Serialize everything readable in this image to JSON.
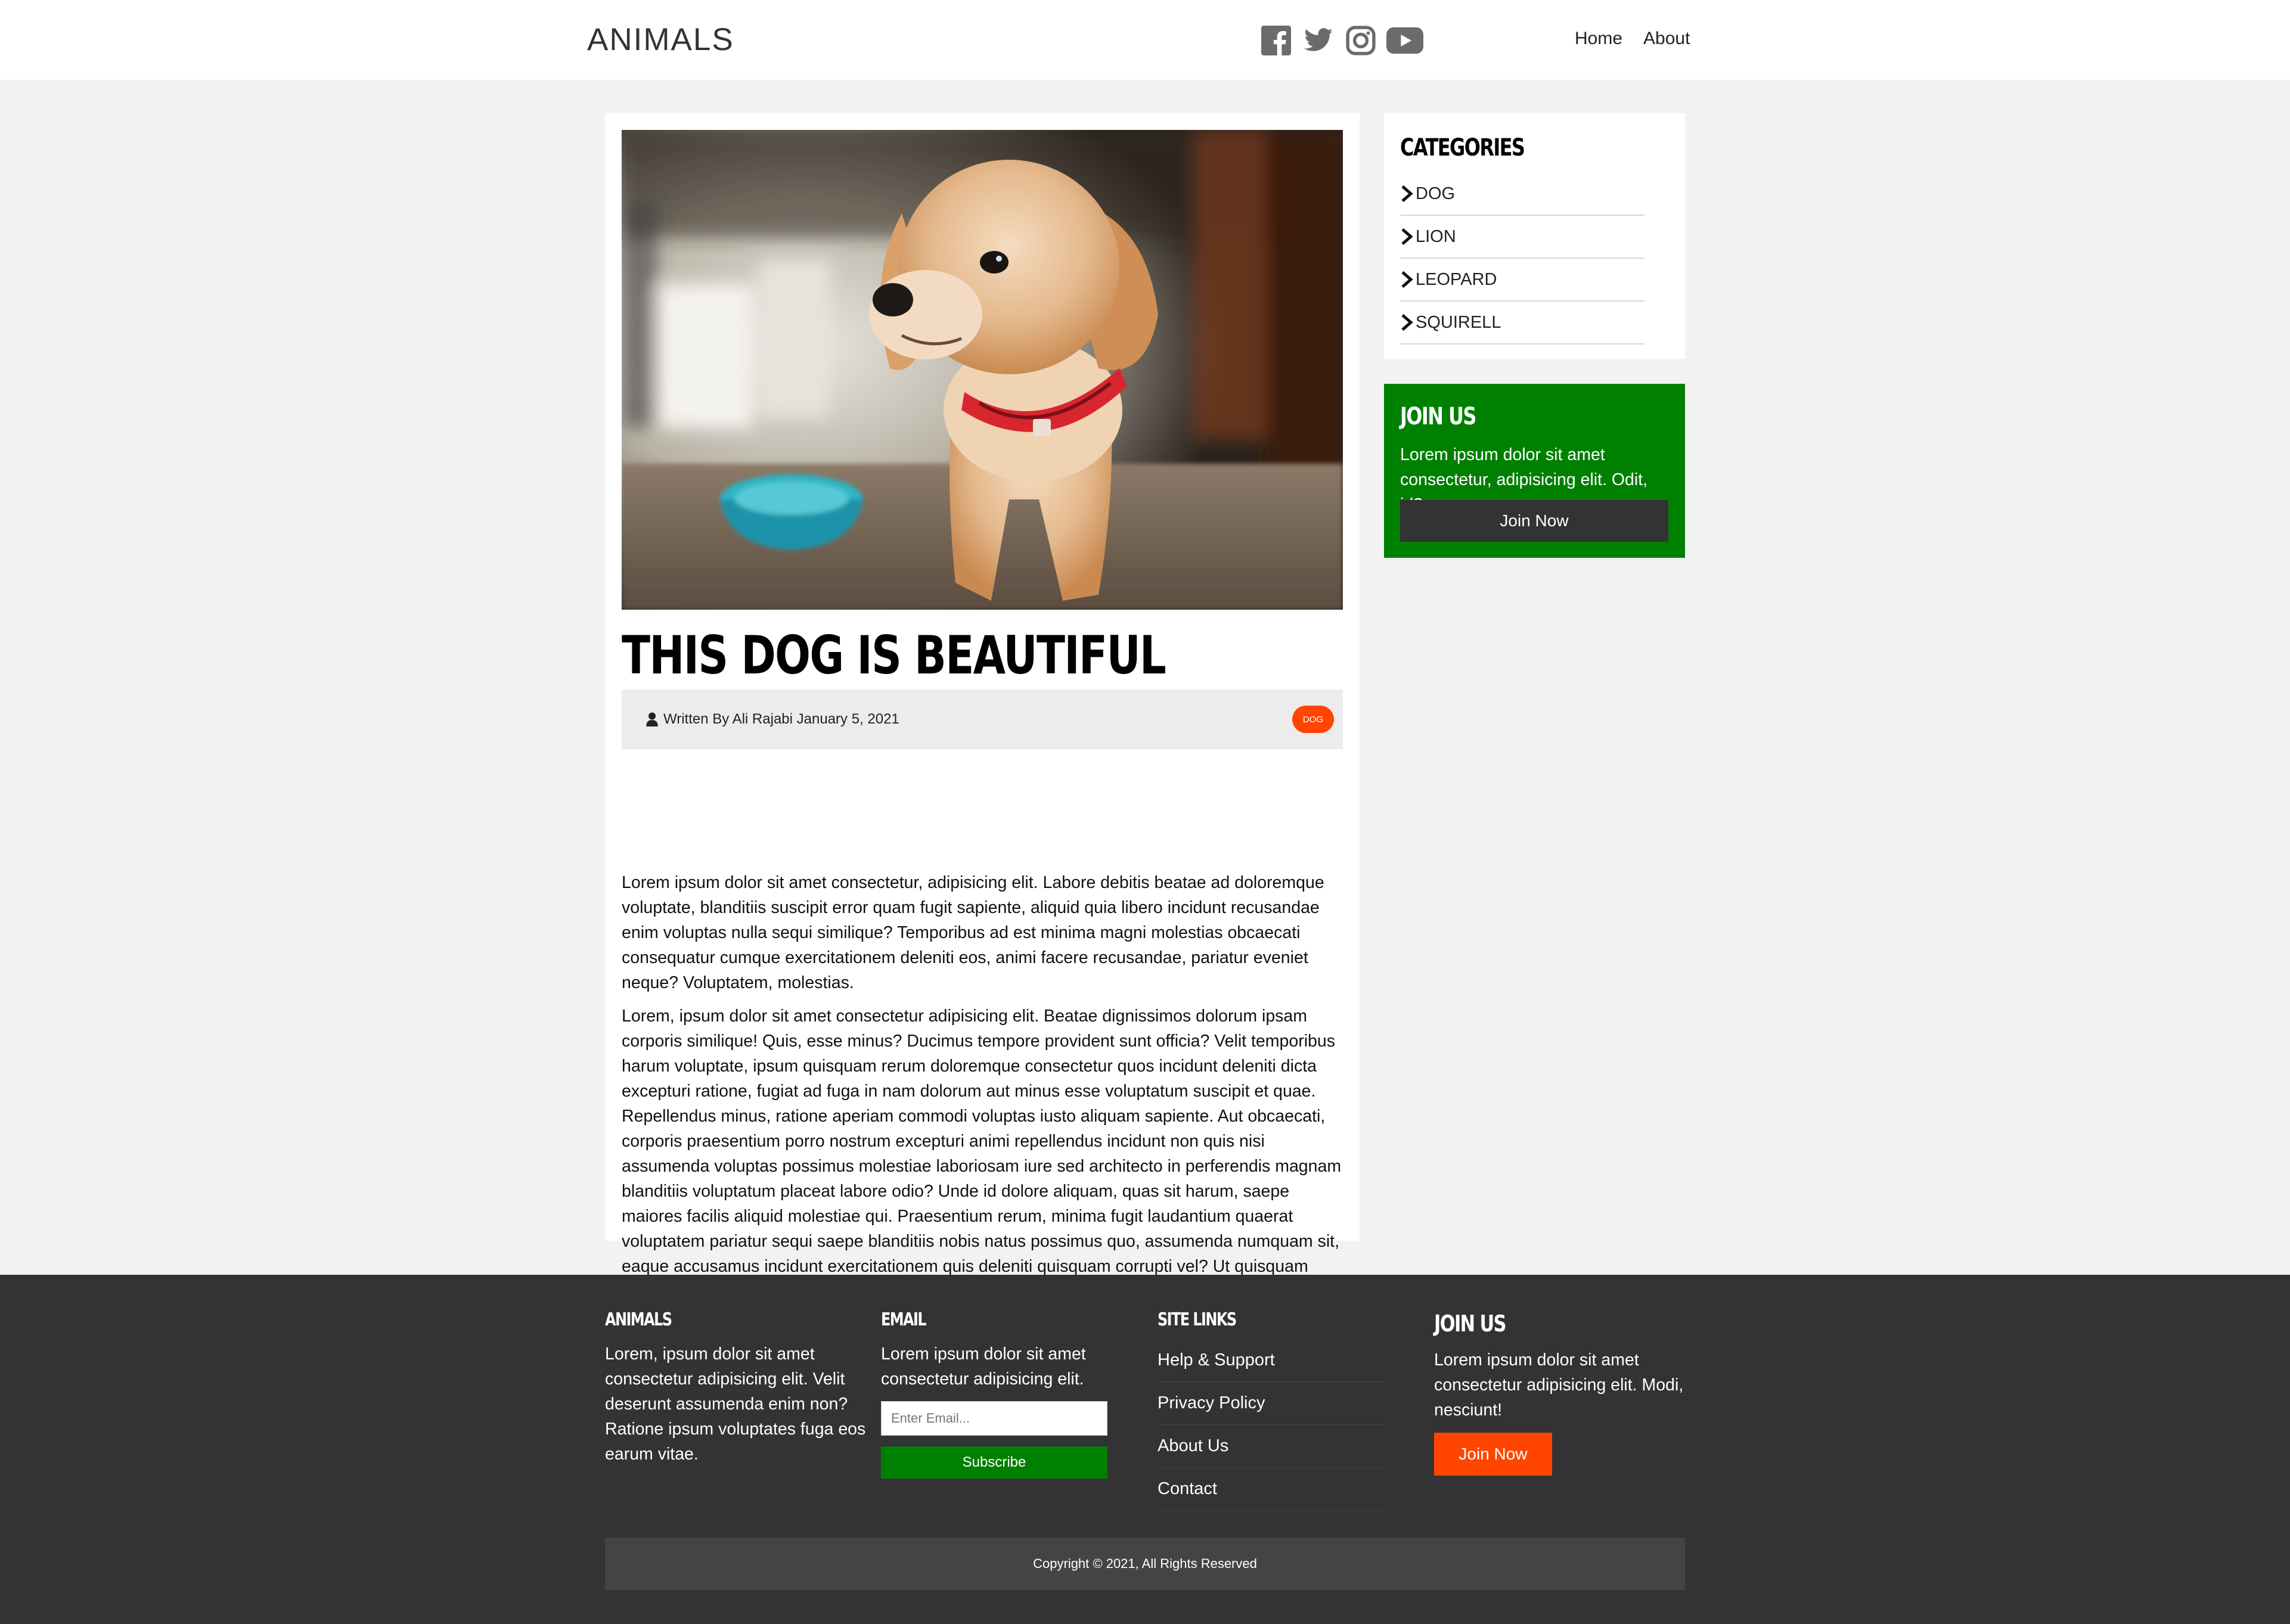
{
  "header": {
    "logo": "ANIMALS",
    "social": [
      {
        "name": "facebook-icon"
      },
      {
        "name": "twitter-icon"
      },
      {
        "name": "instagram-icon"
      },
      {
        "name": "youtube-icon"
      }
    ],
    "nav": [
      {
        "label": "Home"
      },
      {
        "label": "About"
      }
    ]
  },
  "article": {
    "title": "THIS DOG IS BEAUTIFUL",
    "meta": "Written By Ali Rajabi January 5, 2021",
    "tag": "DOG",
    "paragraphs": [
      "Lorem ipsum dolor sit amet consectetur, adipisicing elit. Labore debitis beatae ad doloremque voluptate, blanditiis suscipit error quam fugit sapiente, aliquid quia libero incidunt recusandae enim voluptas nulla sequi similique? Temporibus ad est minima magni molestias obcaecati consequatur cumque exercitationem deleniti eos, animi facere recusandae, pariatur eveniet neque? Voluptatem, molestias.",
      "Lorem, ipsum dolor sit amet consectetur adipisicing elit. Beatae dignissimos dolorum ipsam corporis similique! Quis, esse minus? Ducimus tempore provident sunt officia? Velit temporibus harum voluptate, ipsum quisquam rerum doloremque consectetur quos incidunt deleniti dicta excepturi ratione, fugiat ad fuga in nam dolorum aut minus esse voluptatum suscipit et quae. Repellendus minus, ratione aperiam commodi voluptas iusto aliquam sapiente. Aut obcaecati, corporis praesentium porro nostrum excepturi animi repellendus incidunt non quis nisi assumenda voluptas possimus molestiae laboriosam iure sed architecto in perferendis magnam blanditiis voluptatum placeat labore odio? Unde id dolore aliquam, quas sit harum, saepe maiores facilis aliquid molestiae qui. Praesentium rerum, minima fugit laudantium quaerat voluptatem pariatur sequi saepe blanditiis nobis natus possimus quo, assumenda numquam sit, eaque accusamus incidunt exercitationem quis deleniti quisquam corrupti vel? Ut quisquam consequatur, doloribus voluptatibus iusto quaerat, sint non magnam reiciendis amet quos sapiente excepturi omnis laboriosam nobis, expedita delectus odio provident?"
    ]
  },
  "sidebar": {
    "categories_title": "CATEGORIES",
    "categories": [
      "DOG",
      "LION",
      "LEOPARD",
      "SQUIRELL"
    ],
    "join": {
      "title": "JOIN US",
      "text": "Lorem ipsum dolor sit amet consectetur, adipisicing elit. Odit, id?",
      "button": "Join Now"
    }
  },
  "footer": {
    "animals": {
      "title": "ANIMALS",
      "text": "Lorem, ipsum dolor sit amet consectetur adipisicing elit. Velit deserunt assumenda enim non? Ratione ipsum voluptates fuga eos earum vitae."
    },
    "email": {
      "title": "EMAIL",
      "text": "Lorem ipsum dolor sit amet consectetur adipisicing elit.",
      "placeholder": "Enter Email...",
      "button": "Subscribe"
    },
    "site_links": {
      "title": "SITE LINKS",
      "links": [
        "Help & Support",
        "Privacy Policy",
        "About Us",
        "Contact"
      ]
    },
    "join": {
      "title": "JOIN US",
      "text": "Lorem ipsum dolor sit amet consectetur adipisicing elit. Modi, nesciunt!",
      "button": "Join Now"
    },
    "copyright": "Copyright © 2021, All Rights Reserved"
  },
  "colors": {
    "accent_green": "#008000",
    "accent_orange": "#ff4500",
    "footer_bg": "#333333"
  }
}
